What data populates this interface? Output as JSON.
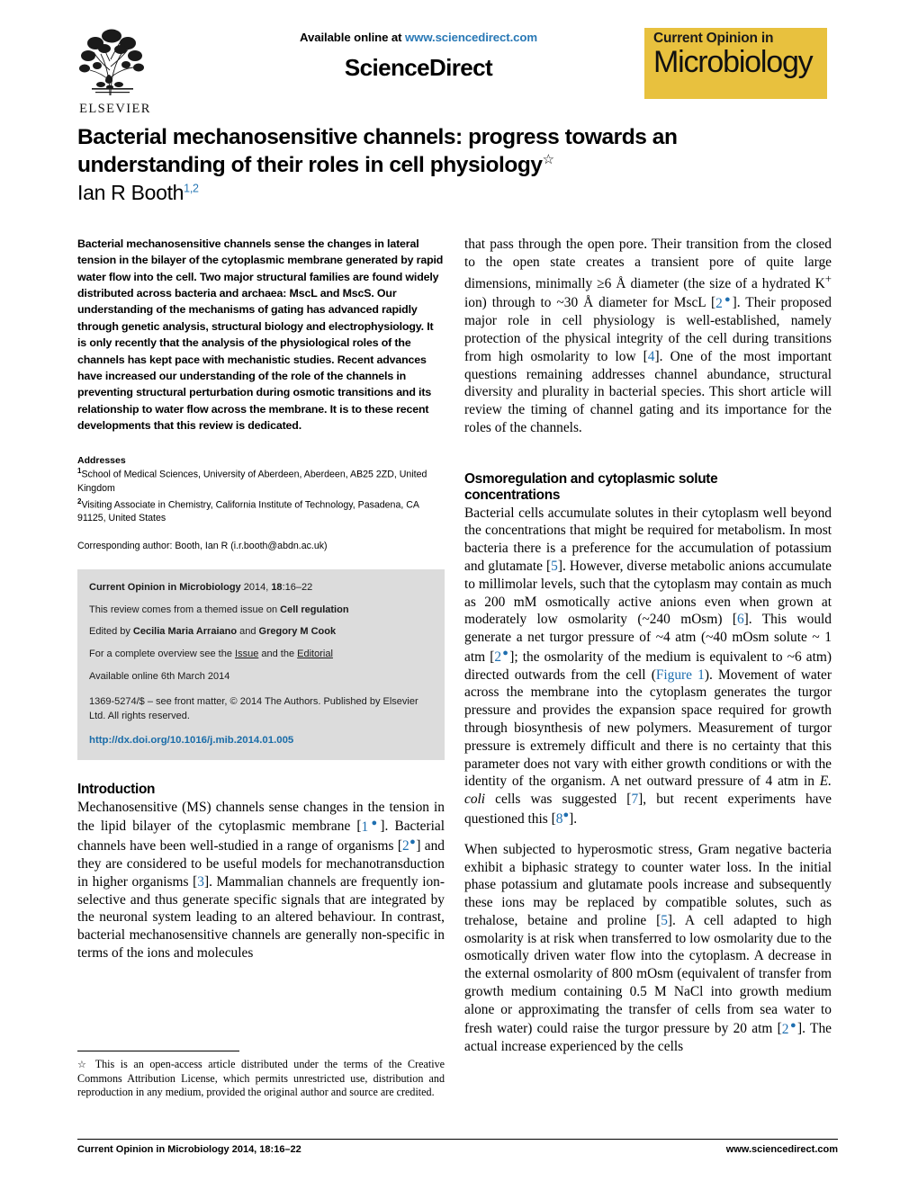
{
  "masthead": {
    "available_prefix": "Available online at ",
    "available_url": "www.sciencedirect.com",
    "sciencedirect_wordmark": "ScienceDirect",
    "elsevier_wordmark": "ELSEVIER",
    "journal_logo_line1": "Current Opinion in",
    "journal_logo_line2": "Microbiology",
    "journal_logo_color": "#e8c13e"
  },
  "title": {
    "line1": "Bacterial mechanosensitive channels: progress towards an",
    "line2": "understanding of their roles in cell physiology",
    "footnote_marker": "☆",
    "author": "Ian R Booth",
    "author_affiliations": "1,2"
  },
  "abstract": {
    "text": "Bacterial mechanosensitive channels sense the changes in lateral tension in the bilayer of the cytoplasmic membrane generated by rapid water flow into the cell. Two major structural families are found widely distributed across bacteria and archaea: MscL and MscS. Our understanding of the mechanisms of gating has advanced rapidly through genetic analysis, structural biology and electrophysiology. It is only recently that the analysis of the physiological roles of the channels has kept pace with mechanistic studies. Recent advances have increased our understanding of the role of the channels in preventing structural perturbation during osmotic transitions and its relationship to water flow across the membrane. It is to these recent developments that this review is dedicated."
  },
  "addresses": {
    "heading": "Addresses",
    "aff1_sup": "1",
    "aff1": "School of Medical Sciences, University of Aberdeen, Aberdeen, AB25 2ZD, United Kingdom",
    "aff2_sup": "2",
    "aff2": "Visiting Associate in Chemistry, California Institute of Technology, Pasadena, CA 91125, United States",
    "corresponding_prefix": "Corresponding author: Booth, Ian R (",
    "corresponding_email": "i.r.booth@abdn.ac.uk",
    "corresponding_suffix": ")"
  },
  "infobox": {
    "citation_journal": "Current Opinion in Microbiology",
    "citation_year": " 2014, ",
    "citation_volume": "18",
    "citation_pages": ":16–22",
    "themed_prefix": "This review comes from a themed issue on ",
    "themed_topic": "Cell regulation",
    "edited_prefix": "Edited by ",
    "editor1": "Cecilia Maria Arraiano",
    "edited_mid": " and ",
    "editor2": "Gregory M Cook",
    "overview_prefix": "For a complete overview see the ",
    "overview_link1": "Issue",
    "overview_mid": " and the ",
    "overview_link2": "Editorial",
    "available_online": "Available online 6th March 2014",
    "frontmatter": "1369-5274/$ – see front matter, © 2014 The Authors. Published by Elsevier Ltd. All rights reserved.",
    "doi": "http://dx.doi.org/10.1016/j.mib.2014.01.005"
  },
  "sections": {
    "introduction_heading": "Introduction",
    "osmoregulation_heading_line1": "Osmoregulation and cytoplasmic solute",
    "osmoregulation_heading_line2": "concentrations"
  },
  "body": {
    "intro_p1_a": "Mechanosensitive (MS) channels sense changes in the tension in the lipid bilayer of the cytoplasmic membrane [",
    "intro_ref1": "1",
    "intro_p1_b": "]. Bacterial channels have been well-studied in a range of organisms [",
    "intro_ref2": "2",
    "intro_p1_c": "] and they are considered to be useful models for mechanotransduction in higher organisms [",
    "intro_ref3": "3",
    "intro_p1_d": "]. Mammalian channels are frequently ion-selective and thus generate specific signals that are integrated by the neuronal system leading to an altered behaviour. In contrast, bacterial mechanosensitive channels are generally non-specific in terms of the ions and molecules",
    "right_p1_a": "that pass through the open pore. Their transition from the closed to the open state creates a transient pore of quite large dimensions, minimally ≥6 Å diameter (the size of a hydrated K",
    "right_p1_sup": "+",
    "right_p1_b": " ion) through to ~30 Å diameter for MscL [",
    "right_ref2": "2",
    "right_p1_c": "]. Their proposed major role in cell physiology is well-established, namely protection of the physical integrity of the cell during transitions from high osmolarity to low [",
    "right_ref4": "4",
    "right_p1_d": "]. One of the most important questions remaining addresses channel abundance, structural diversity and plurality in bacterial species. This short article will review the timing of channel gating and its importance for the roles of the channels.",
    "osmo_p1_a": "Bacterial cells accumulate solutes in their cytoplasm well beyond the concentrations that might be required for metabolism. In most bacteria there is a preference for the accumulation of potassium and glutamate [",
    "osmo_ref5": "5",
    "osmo_p1_b": "]. However, diverse metabolic anions accumulate to millimolar levels, such that the cytoplasm may contain as much as 200 mM osmotically active anions even when grown at moderately low osmolarity (~240 mOsm) [",
    "osmo_ref6": "6",
    "osmo_p1_c": "]. This would generate a net turgor pressure of ~4 atm (~40 mOsm solute ~ 1 atm [",
    "osmo_ref2": "2",
    "osmo_p1_d": "]; the osmolarity of the medium is equivalent to ~6 atm) directed outwards from the cell (",
    "osmo_figref": "Figure 1",
    "osmo_p1_e": "). Movement of water across the membrane into the cytoplasm generates the turgor pressure and provides the expansion space required for growth through biosynthesis of new polymers. Measurement of turgor pressure is extremely difficult and there is no certainty that this parameter does not vary with either growth conditions or with the identity of the organism. A net outward pressure of 4 atm in ",
    "osmo_ecoli": "E. coli",
    "osmo_p1_f": " cells was suggested [",
    "osmo_ref7": "7",
    "osmo_p1_g": "], but recent experiments have questioned this [",
    "osmo_ref8": "8",
    "osmo_p1_h": "].",
    "osmo_p2_a": "When subjected to hyperosmotic stress, Gram negative bacteria exhibit a biphasic strategy to counter water loss. In the initial phase potassium and glutamate pools increase and subsequently these ions may be replaced by compatible solutes, such as trehalose, betaine and proline [",
    "osmo_p2_ref5": "5",
    "osmo_p2_b": "]. A cell adapted to high osmolarity is at risk when transferred to low osmolarity due to the osmotically driven water flow into the cytoplasm. A decrease in the external osmolarity of 800 mOsm (equivalent of transfer from growth medium containing 0.5 ",
    "osmo_p2_m": "M",
    "osmo_p2_c": " NaCl into growth medium alone or approximating the transfer of cells from sea water to fresh water) could raise the turgor pressure by 20 atm [",
    "osmo_p2_ref2": "2",
    "osmo_p2_d": "]. The actual increase experienced by the cells"
  },
  "footnote": {
    "marker": "☆",
    "text": "This is an open-access article distributed under the terms of the Creative Commons Attribution License, which permits unrestricted use, distribution and reproduction in any medium, provided the original author and source are credited."
  },
  "footer": {
    "left": "Current Opinion in Microbiology 2014, 18:16–22",
    "right": "www.sciencedirect.com"
  }
}
